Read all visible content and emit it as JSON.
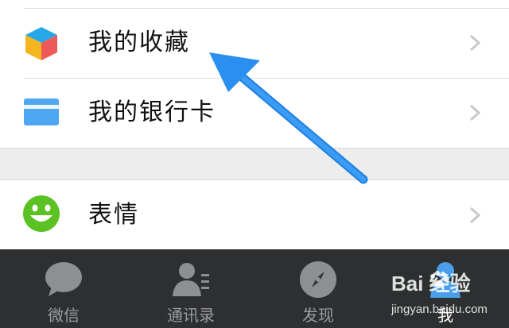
{
  "menu": {
    "items": [
      {
        "label": "我的收藏",
        "icon": "favorites-cube-icon"
      },
      {
        "label": "我的银行卡",
        "icon": "bank-card-icon"
      },
      {
        "label": "表情",
        "icon": "smiley-face-icon"
      }
    ]
  },
  "tabbar": {
    "tabs": [
      {
        "label": "微信",
        "icon": "chat-bubble-icon",
        "active": false
      },
      {
        "label": "通讯录",
        "icon": "contacts-icon",
        "active": false
      },
      {
        "label": "发现",
        "icon": "compass-icon",
        "active": false
      },
      {
        "label": "我",
        "icon": "person-icon",
        "active": true
      }
    ]
  },
  "watermark": {
    "brand": "Bai  经验",
    "url": "jingyan.baidu.com"
  },
  "colors": {
    "accent_arrow": "#2a8ff0",
    "card_blue": "#4fa7f2",
    "smiley_green": "#5cc224",
    "tabbar_bg": "#2d2f31",
    "active_tab": "#4a9eea"
  }
}
